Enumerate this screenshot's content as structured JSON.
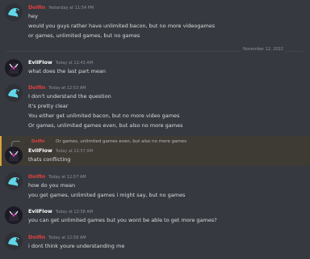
{
  "colors": {
    "background": "#36393f",
    "dolfin": "#e24040",
    "evilflow": "#ffffff",
    "reply_highlight": "#3e3b35",
    "reply_bar": "#d9a33d"
  },
  "date_divider": "November 12, 2022",
  "messages": [
    {
      "author": "Dolfin",
      "time": "Yesterday at 11:54 PM",
      "lines": [
        "hey",
        "would you guys rather have unlimited bacon, but no more videogames",
        "or games, unlimited games, but no games"
      ]
    },
    {
      "author": "EvilFlow",
      "time": "Today at 12:43 AM",
      "lines": [
        "what does the last part mean"
      ]
    },
    {
      "author": "Dolfin",
      "time": "Today at 12:53 AM",
      "lines": [
        "I don't understand the question",
        "It's pretty clear",
        "You either get unlimited bacon, but no more video games",
        "Or games, unlimited games even, but also no more games"
      ]
    },
    {
      "author": "EvilFlow",
      "time": "Today at 12:57 AM",
      "lines": [
        "thats conflicting"
      ],
      "reply": {
        "author": "Dolfin",
        "text": "Or games, unlimited games even, but also no more games"
      }
    },
    {
      "author": "Dolfin",
      "time": "Today at 12:57 AM",
      "lines": [
        "how do you mean",
        "you get games, unlimited games i might say, but no games"
      ]
    },
    {
      "author": "EvilFlow",
      "time": "Today at 12:58 AM",
      "lines": [
        "you can get unlimited games but you wont be able to get more games?"
      ]
    },
    {
      "author": "Dolfin",
      "time": "Today at 12:58 AM",
      "lines": [
        "i dont think youre understanding me"
      ]
    }
  ]
}
